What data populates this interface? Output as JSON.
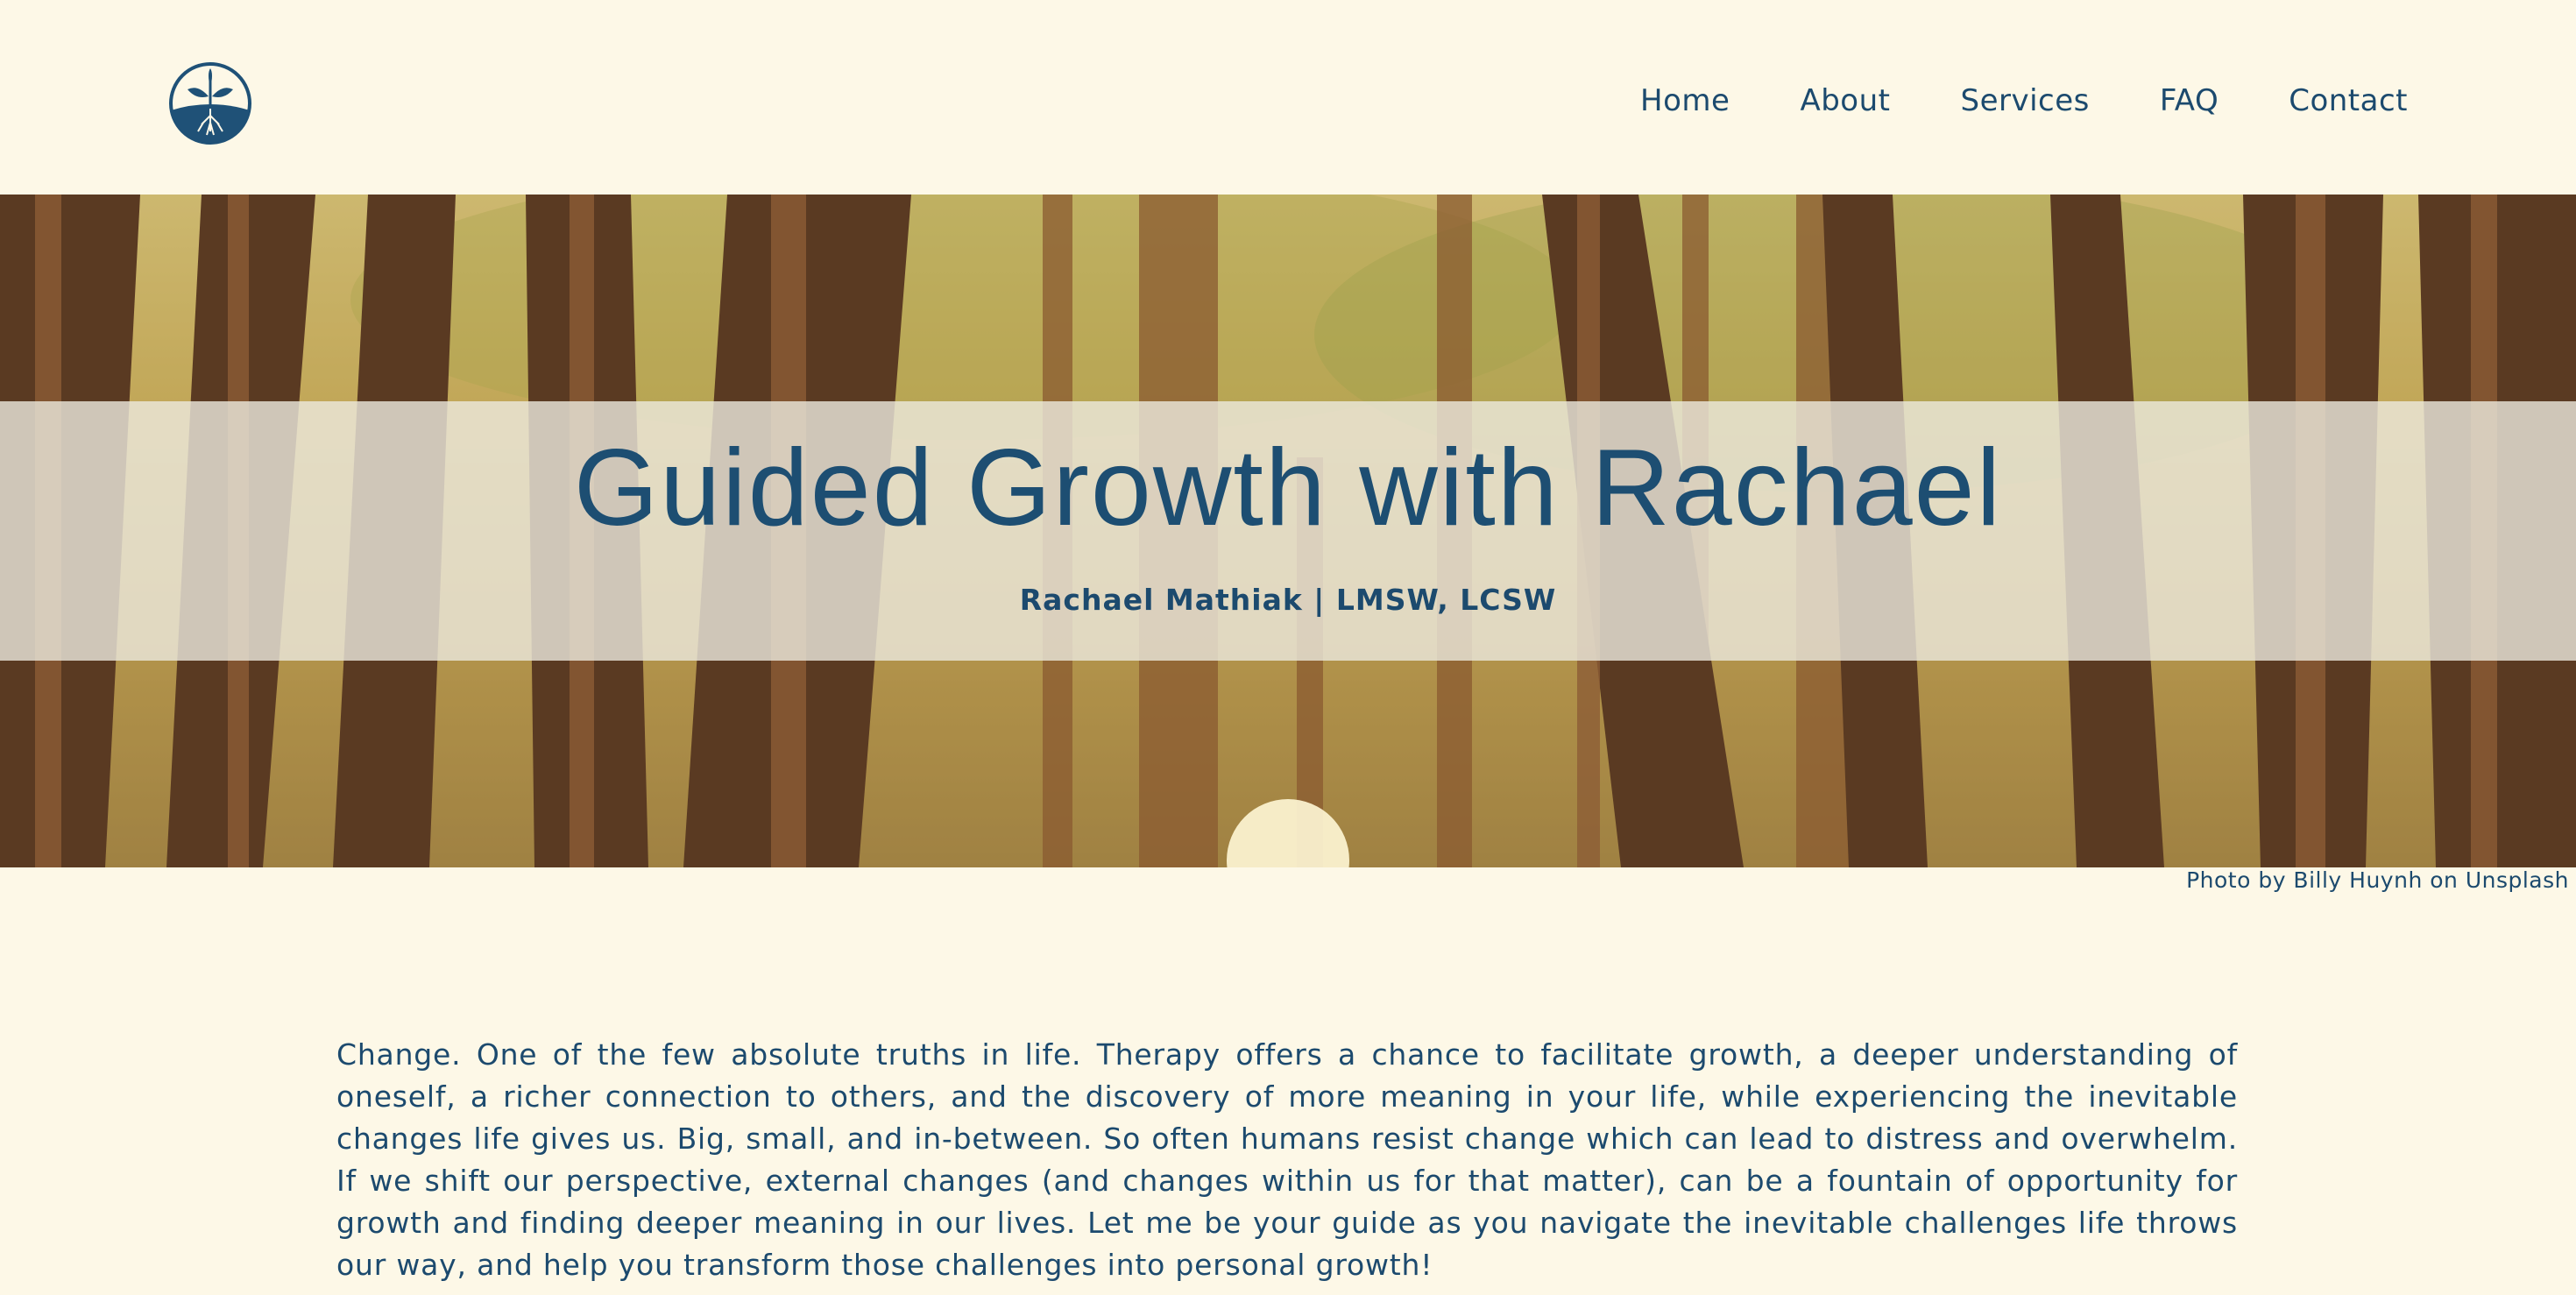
{
  "header": {
    "logo_icon": "sprout-with-roots-icon",
    "nav": [
      {
        "label": "Home"
      },
      {
        "label": "About"
      },
      {
        "label": "Services"
      },
      {
        "label": "FAQ"
      },
      {
        "label": "Contact"
      }
    ]
  },
  "hero": {
    "title": "Guided Growth with Rachael",
    "subtitle": "Rachael Mathiak | LMSW, LCSW",
    "image_caption": "Photo by Billy Huynh on Unsplash"
  },
  "main": {
    "intro_text": "Change. One of the few absolute truths in life. Therapy offers a chance to facilitate growth, a deeper understanding of oneself, a richer connection to others, and the discovery of more meaning in your life, while experiencing the inevitable changes life gives us. Big, small, and in-between. So often humans resist change which can lead to distress and overwhelm. If we shift our perspective, external changes (and changes within us for that matter), can be a fountain of opportunity for growth and finding deeper meaning in our lives. Let me be your guide as you navigate the inevitable challenges life throws our way, and help you transform those challenges into personal growth!"
  },
  "colors": {
    "background": "#fdf8e7",
    "primary_text": "#1c4a6e",
    "hero_title": "#1d4e72"
  }
}
